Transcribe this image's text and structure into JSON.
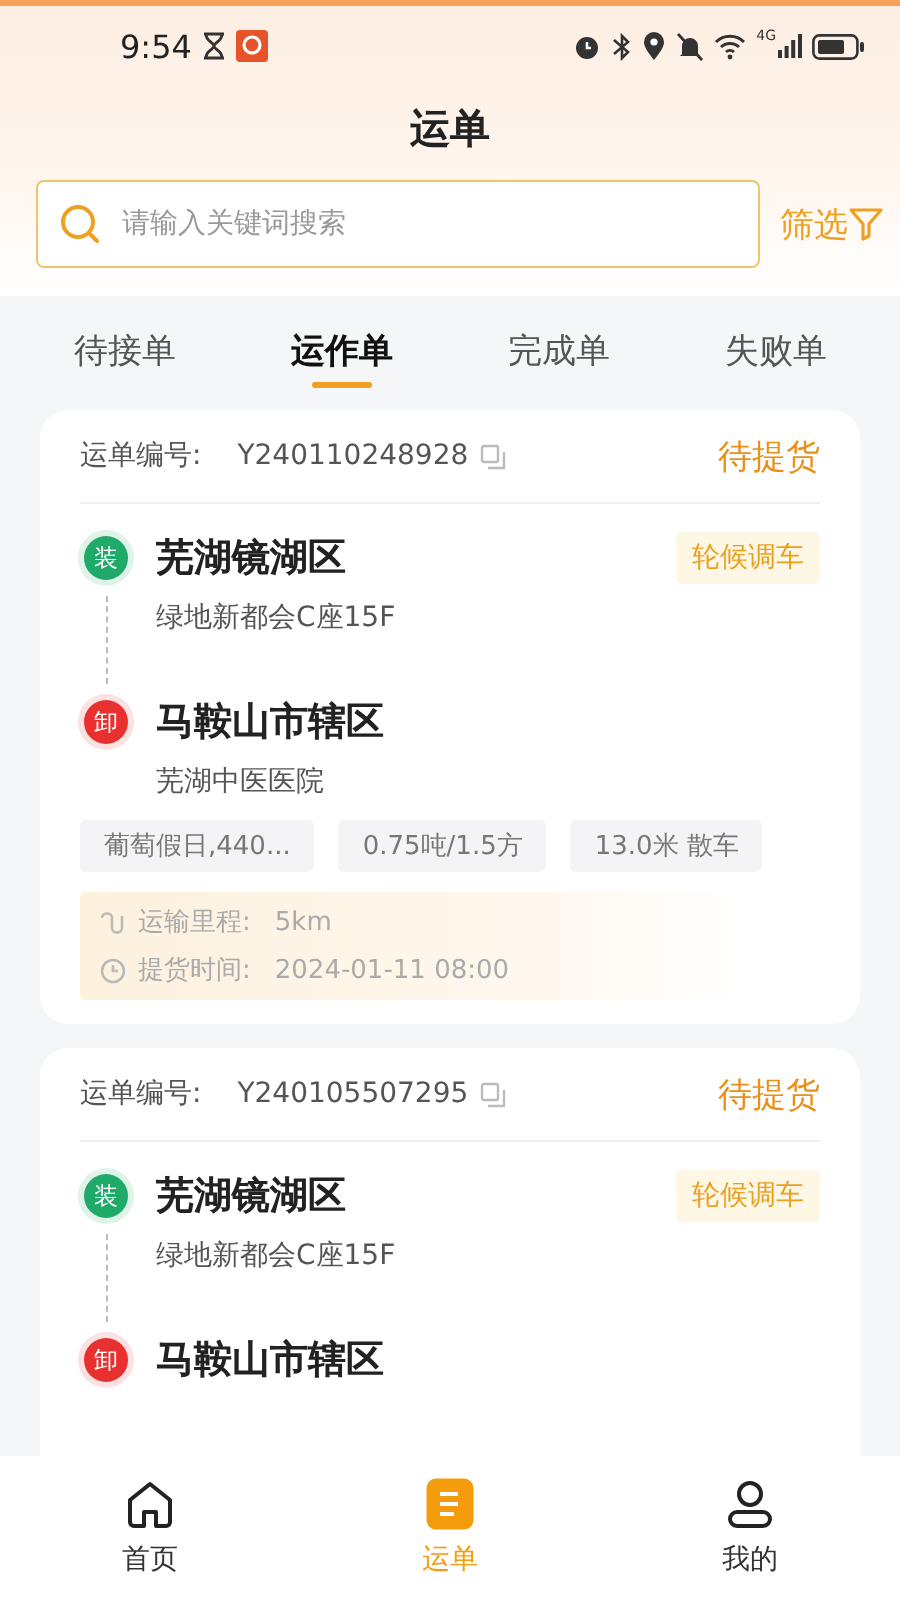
{
  "status_bar": {
    "time": "9:54",
    "network": "4G"
  },
  "title": "运单",
  "search": {
    "placeholder": "请输入关键词搜索"
  },
  "filter": {
    "label": "筛选"
  },
  "tabs": [
    {
      "label": "待接单",
      "selected": false
    },
    {
      "label": "运作单",
      "selected": true
    },
    {
      "label": "完成单",
      "selected": false
    },
    {
      "label": "失败单",
      "selected": false
    }
  ],
  "orders": [
    {
      "number_label": "运单编号:",
      "number": "Y240110248928",
      "status": "待提货",
      "load": {
        "badge": "装",
        "city": "芜湖镜湖区",
        "address": "绿地新都会C座15F",
        "tag": "轮候调车"
      },
      "unload": {
        "badge": "卸",
        "city": "马鞍山市辖区",
        "address": "芜湖中医医院"
      },
      "tags": [
        "葡萄假日,440...",
        "0.75吨/1.5方",
        "13.0米 散车"
      ],
      "info": [
        {
          "kind": "distance",
          "label": "运输里程:",
          "value": "5km"
        },
        {
          "kind": "time",
          "label": "提货时间:",
          "value": "2024-01-11 08:00"
        }
      ]
    },
    {
      "number_label": "运单编号:",
      "number": "Y240105507295",
      "status": "待提货",
      "load": {
        "badge": "装",
        "city": "芜湖镜湖区",
        "address": "绿地新都会C座15F",
        "tag": "轮候调车"
      },
      "unload": {
        "badge": "卸",
        "city": "马鞍山市辖区"
      }
    }
  ],
  "nav": [
    {
      "kind": "home",
      "label": "首页",
      "selected": false
    },
    {
      "kind": "orders",
      "label": "运单",
      "selected": true
    },
    {
      "kind": "profile",
      "label": "我的",
      "selected": false
    }
  ]
}
